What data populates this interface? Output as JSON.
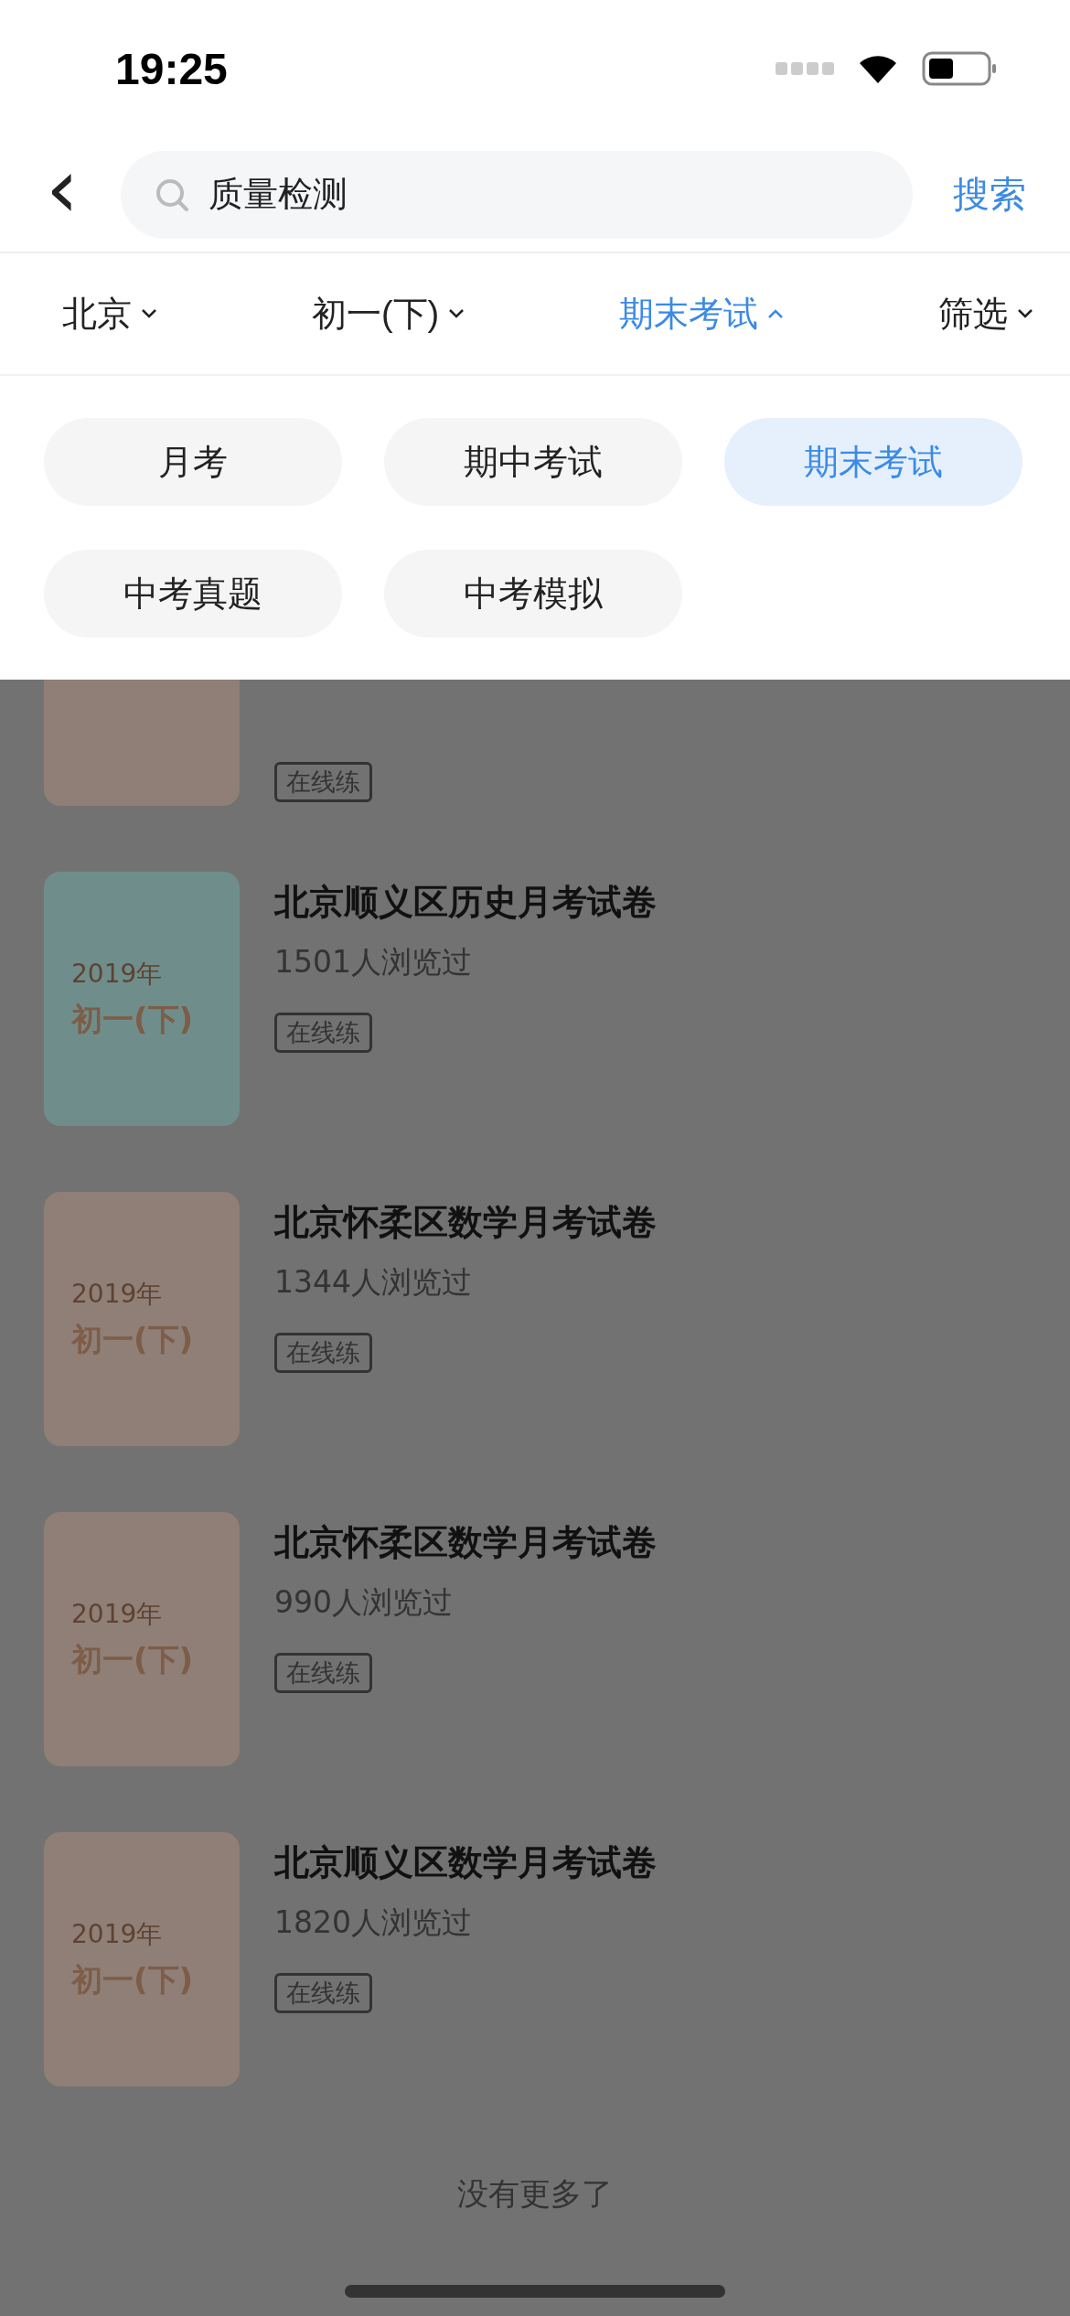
{
  "status_bar": {
    "time": "19:25"
  },
  "search": {
    "back": "‹",
    "value": "质量检测",
    "action": "搜索"
  },
  "filters": [
    {
      "label": "北京",
      "expanded": false
    },
    {
      "label": "初一(下)",
      "expanded": false
    },
    {
      "label": "期末考试",
      "expanded": true
    },
    {
      "label": "筛选",
      "expanded": false
    }
  ],
  "dropdown": {
    "options": [
      {
        "label": "月考",
        "selected": false
      },
      {
        "label": "期中考试",
        "selected": false
      },
      {
        "label": "期末考试",
        "selected": true
      },
      {
        "label": "中考真题",
        "selected": false
      },
      {
        "label": "中考模拟",
        "selected": false
      }
    ]
  },
  "results": [
    {
      "color": "#8f7f77",
      "tag": "在线练"
    },
    {
      "color": "#6f8e8b",
      "year": "2019年",
      "grade": "初一(下)",
      "title": "北京顺义区历史月考试卷",
      "views": "1501人浏览过",
      "tag": "在线练"
    },
    {
      "color": "#8f7f77",
      "year": "2019年",
      "grade": "初一(下)",
      "title": "北京怀柔区数学月考试卷",
      "views": "1344人浏览过",
      "tag": "在线练"
    },
    {
      "color": "#8f7f77",
      "year": "2019年",
      "grade": "初一(下)",
      "title": "北京怀柔区数学月考试卷",
      "views": "990人浏览过",
      "tag": "在线练"
    },
    {
      "color": "#8f7f77",
      "year": "2019年",
      "grade": "初一(下)",
      "title": "北京顺义区数学月考试卷",
      "views": "1820人浏览过",
      "tag": "在线练"
    }
  ],
  "footer": "没有更多了"
}
